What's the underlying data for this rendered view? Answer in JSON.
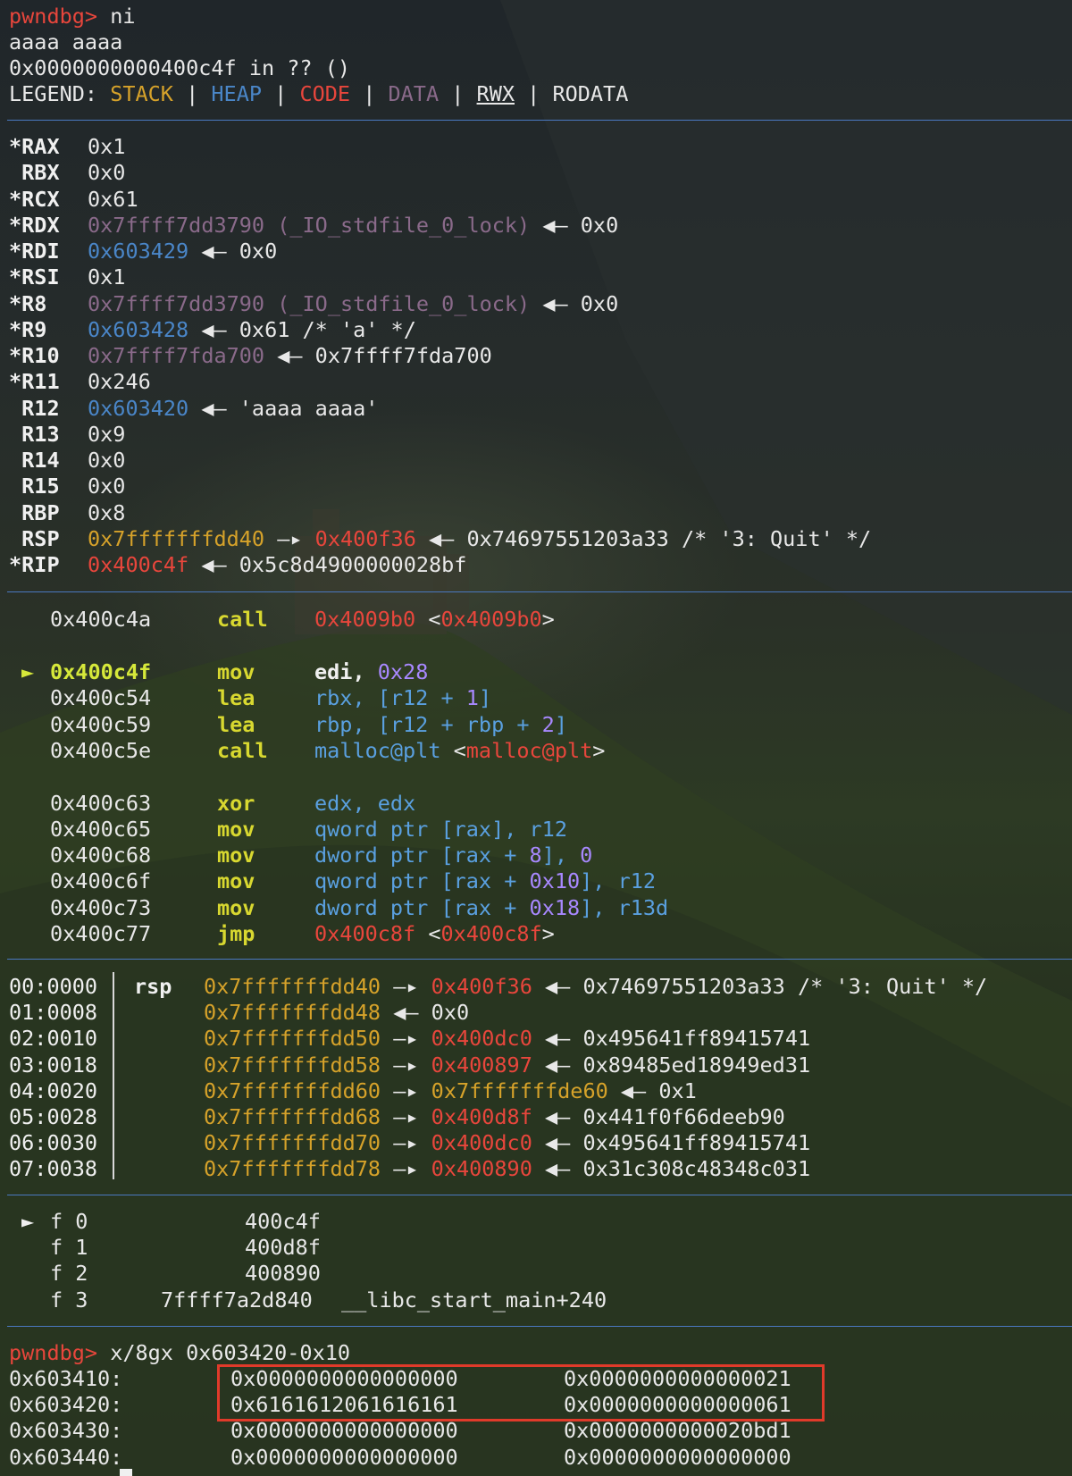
{
  "header": {
    "prompt": "pwndbg>",
    "command": " ni",
    "output1": "aaaa aaaa",
    "output2": "0x0000000000400c4f in ?? ()",
    "legend_label": "LEGEND:",
    "legend": {
      "stack": "STACK",
      "heap": "HEAP",
      "code": "CODE",
      "data": "DATA",
      "rwx": "RWX",
      "rodata": "RODATA"
    },
    "sep": " | "
  },
  "registers": [
    {
      "name": "*RAX",
      "value": "0x1",
      "rest": ""
    },
    {
      "name": " RBX",
      "value": "0x0",
      "rest": ""
    },
    {
      "name": "*RCX",
      "value": "0x61",
      "rest": ""
    },
    {
      "name": "*RDX",
      "value": "0x7ffff7dd3790 (_IO_stdfile_0_lock)",
      "rest": " ◀— 0x0"
    },
    {
      "name": "*RDI",
      "value": "0x603429",
      "rest": " ◀— 0x0"
    },
    {
      "name": "*RSI",
      "value": "0x1",
      "rest": ""
    },
    {
      "name": "*R8",
      "value": "0x7ffff7dd3790 (_IO_stdfile_0_lock)",
      "rest": " ◀— 0x0"
    },
    {
      "name": "*R9",
      "value": "0x603428",
      "rest": " ◀— 0x61 /* 'a' */"
    },
    {
      "name": "*R10",
      "value": "0x7ffff7fda700",
      "rest": " ◀— 0x7ffff7fda700"
    },
    {
      "name": "*R11",
      "value": "0x246",
      "rest": ""
    },
    {
      "name": " R12",
      "value": "0x603420",
      "rest": " ◀— 'aaaa aaaa'"
    },
    {
      "name": " R13",
      "value": "0x9",
      "rest": ""
    },
    {
      "name": " R14",
      "value": "0x0",
      "rest": ""
    },
    {
      "name": " R15",
      "value": "0x0",
      "rest": ""
    },
    {
      "name": " RBP",
      "value": "0x8",
      "rest": ""
    },
    {
      "name": " RSP",
      "value": "0x7fffffffdd40",
      "arrow": " —▸ ",
      "target": "0x400f36",
      "rest": " ◀— 0x74697551203a33 /* '3: Quit' */"
    },
    {
      "name": "*RIP",
      "value": "0x400c4f",
      "rest": " ◀— 0x5c8d4900000028bf"
    }
  ],
  "disasm": [
    {
      "addr": "0x400c4a",
      "op": "call",
      "arg1": "0x4009b0",
      "arg2": " <",
      "arg3": "0x4009b0",
      "arg4": ">"
    },
    {
      "addr": "0x400c4f",
      "op": "mov",
      "operands": "edi, ",
      "imm": "0x28",
      "current": "►"
    },
    {
      "addr": "0x400c54",
      "op": "lea",
      "operands": "rbx, [r12 + ",
      "imm": "1",
      "tail": "]"
    },
    {
      "addr": "0x400c59",
      "op": "lea",
      "operands": "rbp, [r12 + rbp + ",
      "imm": "2",
      "tail": "]"
    },
    {
      "addr": "0x400c5e",
      "op": "call",
      "arg1": "malloc@plt",
      "arg2": " <",
      "arg3": "malloc@plt",
      "arg4": ">"
    },
    {
      "addr": "0x400c63",
      "op": "xor",
      "operands": "edx, edx"
    },
    {
      "addr": "0x400c65",
      "op": "mov",
      "operands": "qword ptr [rax], r12"
    },
    {
      "addr": "0x400c68",
      "op": "mov",
      "operands": "dword ptr [rax + ",
      "imm": "8",
      "tail": "], ",
      "imm2": "0"
    },
    {
      "addr": "0x400c6f",
      "op": "mov",
      "operands": "qword ptr [rax + ",
      "imm": "0x10",
      "tail": "], r12"
    },
    {
      "addr": "0x400c73",
      "op": "mov",
      "operands": "dword ptr [rax + ",
      "imm": "0x18",
      "tail": "], r13d"
    },
    {
      "addr": "0x400c77",
      "op": "jmp",
      "arg1": "0x400c8f",
      "arg2": " <",
      "arg3": "0x400c8f",
      "arg4": ">"
    }
  ],
  "stack": [
    {
      "off": "00:0000",
      "reg": "rsp",
      "addr": "0x7fffffffdd40",
      "arrow": " —▸ ",
      "ptr": "0x400f36",
      "rest": " ◀— 0x74697551203a33 /* '3: Quit' */"
    },
    {
      "off": "01:0008",
      "reg": "",
      "addr": "0x7fffffffdd48",
      "arrow": " ◀— ",
      "ptr": "",
      "rest": "0x0"
    },
    {
      "off": "02:0010",
      "reg": "",
      "addr": "0x7fffffffdd50",
      "arrow": " —▸ ",
      "ptr": "0x400dc0",
      "rest": " ◀— 0x495641ff89415741"
    },
    {
      "off": "03:0018",
      "reg": "",
      "addr": "0x7fffffffdd58",
      "arrow": " —▸ ",
      "ptr": "0x400897",
      "rest": " ◀— 0x89485ed18949ed31"
    },
    {
      "off": "04:0020",
      "reg": "",
      "addr": "0x7fffffffdd60",
      "arrow": " —▸ ",
      "ptr": "0x7fffffffde60",
      "rest": " ◀— 0x1"
    },
    {
      "off": "05:0028",
      "reg": "",
      "addr": "0x7fffffffdd68",
      "arrow": " —▸ ",
      "ptr": "0x400d8f",
      "rest": " ◀— 0x441f0f66deeb90"
    },
    {
      "off": "06:0030",
      "reg": "",
      "addr": "0x7fffffffdd70",
      "arrow": " —▸ ",
      "ptr": "0x400dc0",
      "rest": " ◀— 0x495641ff89415741"
    },
    {
      "off": "07:0038",
      "reg": "",
      "addr": "0x7fffffffdd78",
      "arrow": " —▸ ",
      "ptr": "0x400890",
      "rest": " ◀— 0x31c308c48348c031"
    }
  ],
  "backtrace": [
    {
      "marker": "►",
      "frame": "f 0",
      "addr": "400c4f",
      "sym": ""
    },
    {
      "marker": "",
      "frame": "f 1",
      "addr": "400d8f",
      "sym": ""
    },
    {
      "marker": "",
      "frame": "f 2",
      "addr": "400890",
      "sym": ""
    },
    {
      "marker": "",
      "frame": "f 3",
      "addr": "7ffff7a2d840",
      "sym": "__libc_start_main+240"
    }
  ],
  "examine": {
    "prompt": "pwndbg>",
    "command": " x/8gx 0x603420-0x10",
    "rows": [
      {
        "addr": "0x603410:",
        "v1": "0x0000000000000000",
        "v2": "0x0000000000000021"
      },
      {
        "addr": "0x603420:",
        "v1": "0x6161612061616161",
        "v2": "0x0000000000000061"
      },
      {
        "addr": "0x603430:",
        "v1": "0x0000000000000000",
        "v2": "0x0000000000020bd1"
      },
      {
        "addr": "0x603440:",
        "v1": "0x0000000000000000",
        "v2": "0x0000000000000000"
      }
    ]
  },
  "colors": {
    "stack": "#d6a22a",
    "heap": "#4a86c8",
    "code": "#e8463c",
    "data": "#8a6a8a",
    "separator": "#4a78c0",
    "highlight_box": "#e03a2a"
  }
}
